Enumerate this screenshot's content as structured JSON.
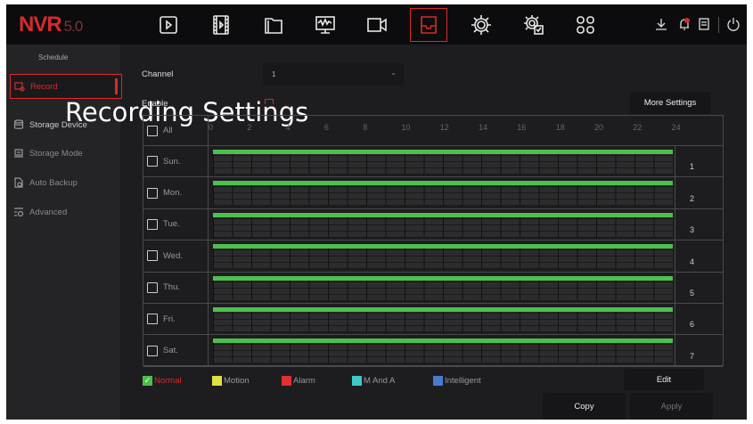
{
  "logo": {
    "name": "NVR",
    "version": "5.0"
  },
  "top_icons": [
    "playback-icon",
    "video-clip-icon",
    "file-folder-icon",
    "monitor-icon",
    "camera-icon",
    "storage-tray-icon",
    "settings-gear-icon",
    "system-settings-icon",
    "apps-grid-icon"
  ],
  "right_icons": [
    "download-icon",
    "alarm-bell-icon",
    "info-icon",
    "power-icon"
  ],
  "sidebar": {
    "heading": "Schedule",
    "items": [
      {
        "label": "Record",
        "selected": true
      },
      {
        "label": "Storage Device"
      },
      {
        "label": "Storage Mode"
      },
      {
        "label": "Auto Backup"
      },
      {
        "label": "Advanced"
      }
    ]
  },
  "overlay_title": "Recording Settings",
  "form": {
    "channel_label": "Channel",
    "channel_value": "1",
    "enable_label": "Enable",
    "more_settings": "More Settings"
  },
  "grid": {
    "all_label": "All",
    "hours": [
      "0",
      "2",
      "4",
      "6",
      "8",
      "10",
      "12",
      "14",
      "16",
      "18",
      "20",
      "22",
      "24"
    ],
    "days": [
      {
        "label": "Sun.",
        "num": "1"
      },
      {
        "label": "Mon.",
        "num": "2"
      },
      {
        "label": "Tue.",
        "num": "3"
      },
      {
        "label": "Wed.",
        "num": "4"
      },
      {
        "label": "Thu.",
        "num": "5"
      },
      {
        "label": "Fri.",
        "num": "6"
      },
      {
        "label": "Sat.",
        "num": "7"
      }
    ]
  },
  "legend": [
    {
      "label": "Normal",
      "color": "#4cc04c",
      "checked": true
    },
    {
      "label": "Motion",
      "color": "#e0e040"
    },
    {
      "label": "Alarm",
      "color": "#e03030"
    },
    {
      "label": "M And A",
      "color": "#40c8c8"
    },
    {
      "label": "Intelligent",
      "color": "#4a7ad0"
    }
  ],
  "buttons": {
    "edit": "Edit",
    "copy": "Copy",
    "apply": "Apply"
  }
}
